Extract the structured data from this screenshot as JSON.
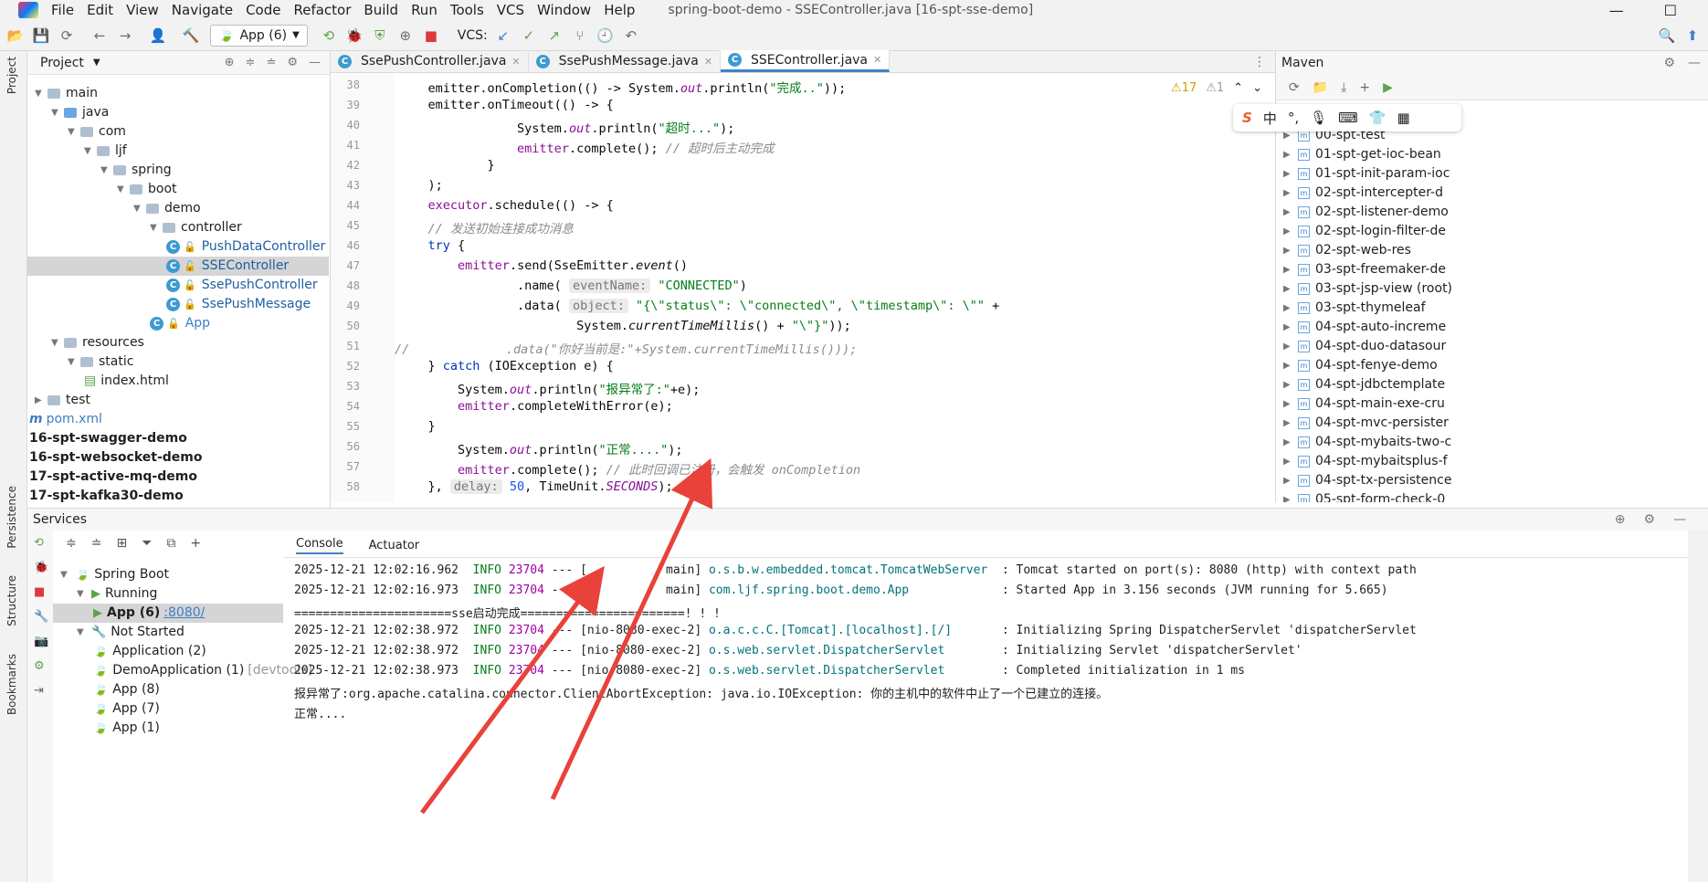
{
  "menubar": {
    "items": [
      "File",
      "Edit",
      "View",
      "Navigate",
      "Code",
      "Refactor",
      "Build",
      "Run",
      "Tools",
      "VCS",
      "Window",
      "Help"
    ],
    "title": "spring-boot-demo - SSEController.java [16-spt-sse-demo]",
    "minimize": "—",
    "maximize": "☐"
  },
  "toolbar": {
    "run_config": "App (6)",
    "vcs_label": "VCS:"
  },
  "project": {
    "title": "Project",
    "tree": [
      {
        "label": "main",
        "indent": 0,
        "type": "folder"
      },
      {
        "label": "java",
        "indent": 1,
        "type": "folder-blue"
      },
      {
        "label": "com",
        "indent": 2,
        "type": "folder"
      },
      {
        "label": "ljf",
        "indent": 3,
        "type": "folder"
      },
      {
        "label": "spring",
        "indent": 4,
        "type": "folder"
      },
      {
        "label": "boot",
        "indent": 5,
        "type": "folder"
      },
      {
        "label": "demo",
        "indent": 6,
        "type": "folder"
      },
      {
        "label": "controller",
        "indent": 7,
        "type": "folder"
      },
      {
        "label": "PushDataController",
        "indent": 8,
        "type": "class"
      },
      {
        "label": "SSEController",
        "indent": 8,
        "type": "class",
        "selected": true
      },
      {
        "label": "SsePushController",
        "indent": 8,
        "type": "class"
      },
      {
        "label": "SsePushMessage",
        "indent": 8,
        "type": "class"
      },
      {
        "label": "App",
        "indent": 7,
        "type": "class"
      },
      {
        "label": "resources",
        "indent": 1,
        "type": "folder"
      },
      {
        "label": "static",
        "indent": 2,
        "type": "folder"
      },
      {
        "label": "index.html",
        "indent": 3,
        "type": "html"
      },
      {
        "label": "test",
        "indent": 0,
        "type": "folder"
      },
      {
        "label": "pom.xml",
        "indent": -1,
        "type": "maven"
      },
      {
        "label": "16-spt-swagger-demo",
        "indent": -1,
        "type": "module"
      },
      {
        "label": "16-spt-websocket-demo",
        "indent": -1,
        "type": "module"
      },
      {
        "label": "17-spt-active-mq-demo",
        "indent": -1,
        "type": "module"
      },
      {
        "label": "17-spt-kafka30-demo",
        "indent": -1,
        "type": "module"
      }
    ]
  },
  "side_tabs": {
    "project": "Project",
    "persistence": "Persistence",
    "structure": "Structure",
    "bookmarks": "Bookmarks"
  },
  "editor": {
    "tabs": [
      {
        "label": "SsePushController.java",
        "active": false
      },
      {
        "label": "SsePushMessage.java",
        "active": false
      },
      {
        "label": "SSEController.java",
        "active": true
      }
    ],
    "warnings": "⚠17",
    "weak_warnings": "⚠1",
    "line_numbers": [
      "38",
      "39",
      "40",
      "41",
      "42",
      "43",
      "44",
      "45",
      "46",
      "47",
      "48",
      "49",
      "50",
      "51",
      "52",
      "53",
      "54",
      "55",
      "56",
      "57",
      "58"
    ]
  },
  "maven": {
    "title": "Maven",
    "modules": [
      "00-spt-test",
      "01-spt-get-ioc-bean",
      "01-spt-init-param-ioc",
      "02-spt-intercepter-d",
      "02-spt-listener-demo",
      "02-spt-login-filter-de",
      "02-spt-web-res",
      "03-spt-freemaker-de",
      "03-spt-jsp-view (root)",
      "03-spt-thymeleaf",
      "04-spt-auto-increme",
      "04-spt-duo-datasour",
      "04-spt-fenye-demo",
      "04-spt-jdbctemplate",
      "04-spt-main-exe-cru",
      "04-spt-mvc-persister",
      "04-spt-mybaits-two-c",
      "04-spt-mybaitsplus-f",
      "04-spt-tx-persistence",
      "05-spt-form-check-0"
    ]
  },
  "services": {
    "title": "Services",
    "tree": [
      {
        "label": "Spring Boot",
        "indent": 0
      },
      {
        "label": "Running",
        "indent": 1
      },
      {
        "label": "App (6)",
        "indent": 2,
        "link": ":8080/",
        "selected": true
      },
      {
        "label": "Not Started",
        "indent": 1
      },
      {
        "label": "Application (2)",
        "indent": 2
      },
      {
        "label": "DemoApplication (1)",
        "indent": 2,
        "suffix": "[devtools]"
      },
      {
        "label": "App (8)",
        "indent": 2
      },
      {
        "label": "App (7)",
        "indent": 2
      },
      {
        "label": "App (1)",
        "indent": 2
      }
    ],
    "console_tabs": [
      "Console",
      "Actuator"
    ],
    "log": [
      {
        "ts": "2025-12-21 12:02:16.962",
        "level": "INFO",
        "pid": "23704",
        "thread": "[           main]",
        "logger": "o.s.b.w.embedded.tomcat.TomcatWebServer ",
        "msg": ": Tomcat started on port(s): 8080 (http) with context path ''"
      },
      {
        "ts": "2025-12-21 12:02:16.973",
        "level": "INFO",
        "pid": "23704",
        "thread": "[           main]",
        "logger": "com.ljf.spring.boot.demo.App            ",
        "msg": ": Started App in 3.156 seconds (JVM running for 5.665)"
      },
      {
        "plain": "======================sse启动完成=======================! ! !"
      },
      {
        "ts": "2025-12-21 12:02:38.972",
        "level": "INFO",
        "pid": "23704",
        "thread": "[nio-8080-exec-2]",
        "logger": "o.a.c.c.C.[Tomcat].[localhost].[/]      ",
        "msg": ": Initializing Spring DispatcherServlet 'dispatcherServlet'"
      },
      {
        "ts": "2025-12-21 12:02:38.972",
        "level": "INFO",
        "pid": "23704",
        "thread": "[nio-8080-exec-2]",
        "logger": "o.s.web.servlet.DispatcherServlet       ",
        "msg": ": Initializing Servlet 'dispatcherServlet'"
      },
      {
        "ts": "2025-12-21 12:02:38.973",
        "level": "INFO",
        "pid": "23704",
        "thread": "[nio-8080-exec-2]",
        "logger": "o.s.web.servlet.DispatcherServlet       ",
        "msg": ": Completed initialization in 1 ms"
      },
      {
        "plain": "报异常了:org.apache.catalina.connector.ClientAbortException: java.io.IOException: 你的主机中的软件中止了一个已建立的连接。"
      },
      {
        "plain": "正常...."
      }
    ]
  },
  "ime": {
    "chars": [
      "S",
      "中",
      "°,",
      "🎙",
      "⌨",
      "👕",
      "▦"
    ]
  },
  "colors": {
    "accent": "#4083c9",
    "keyword": "#0033b3",
    "string": "#067d17",
    "annotation_arrow": "#e8423a"
  }
}
